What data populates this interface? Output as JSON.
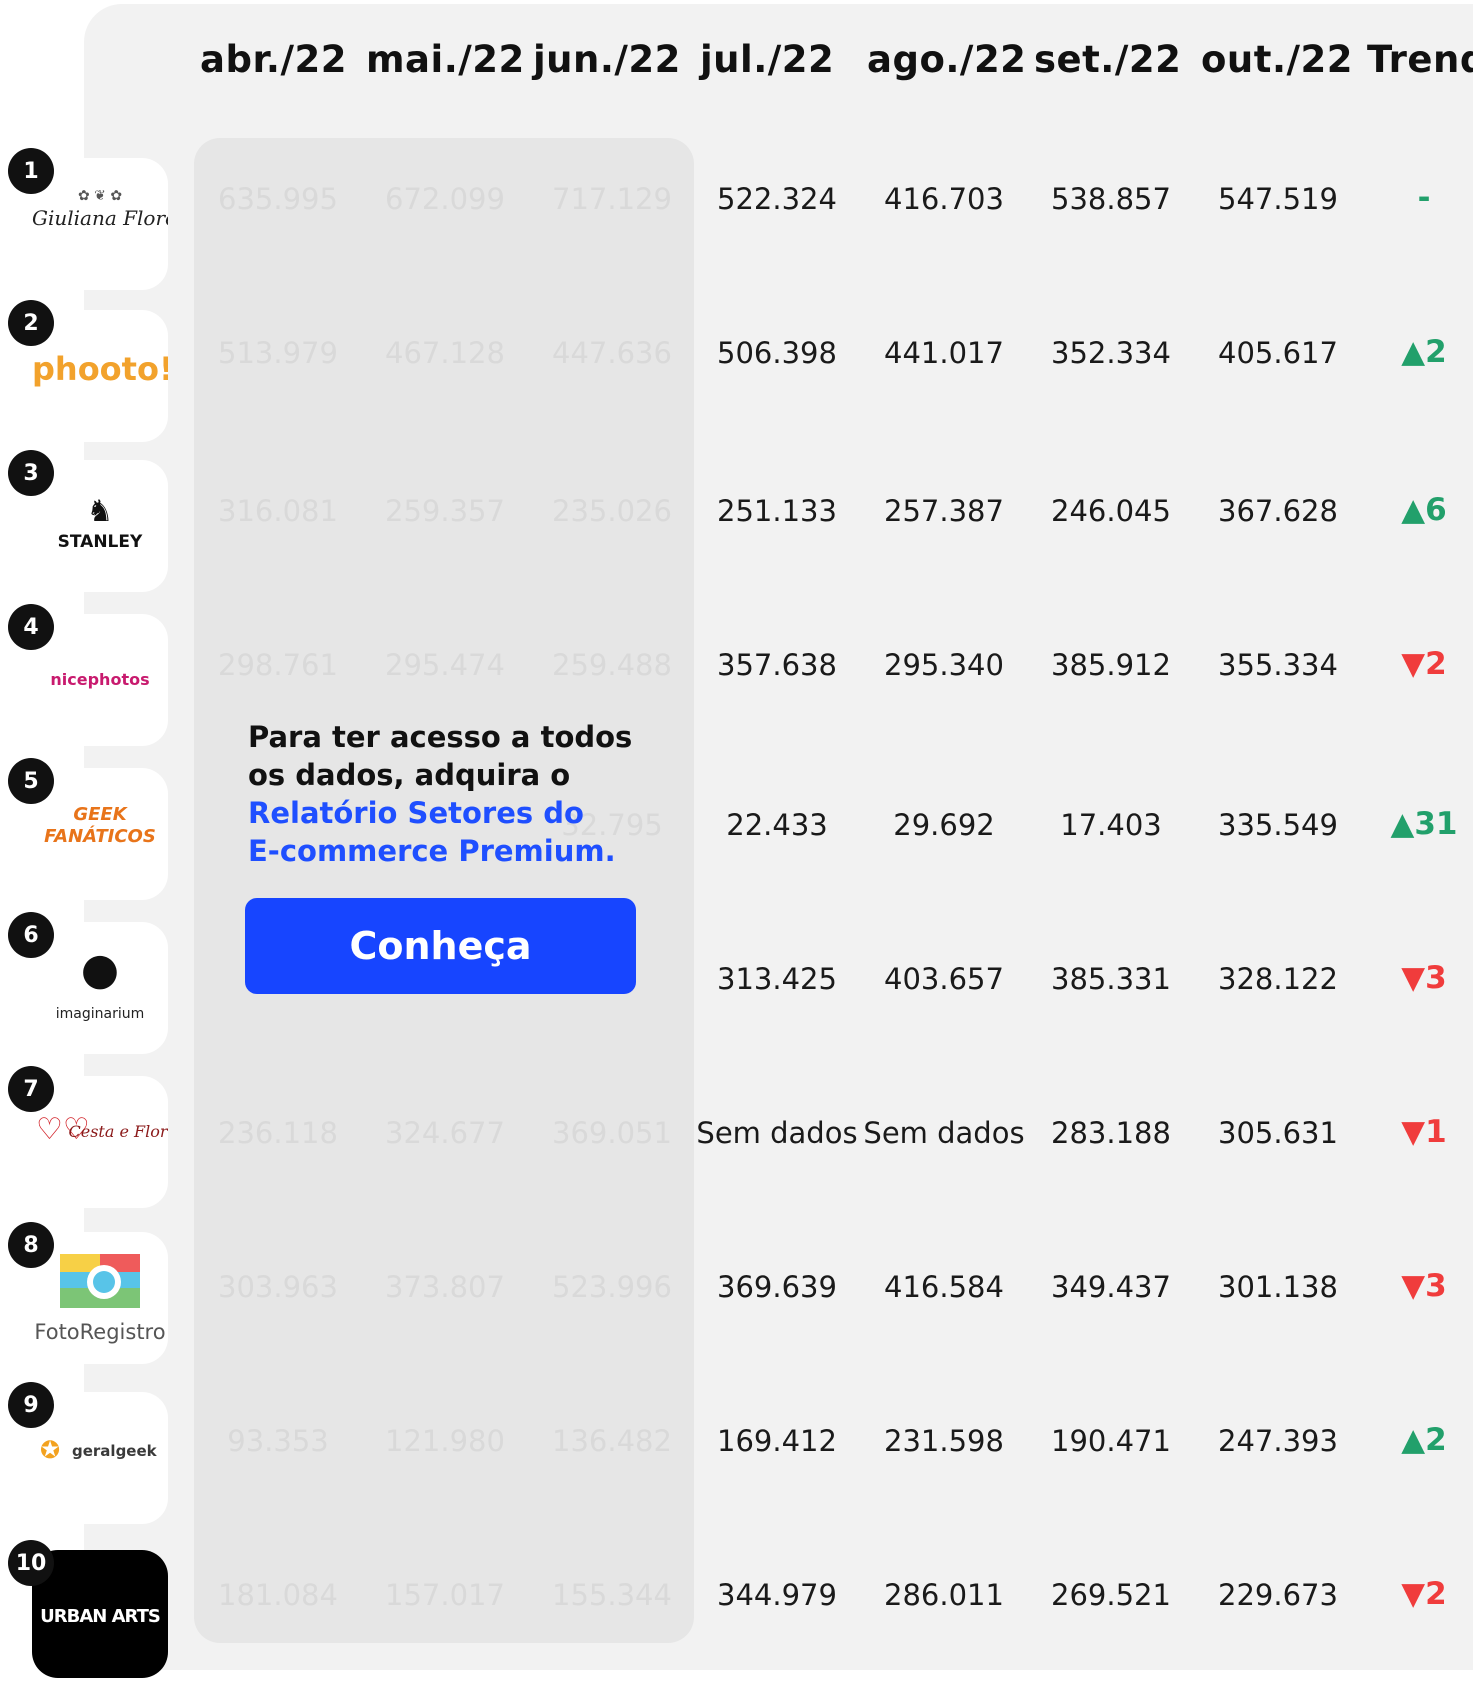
{
  "header": {
    "months": [
      "abr./22",
      "mai./22",
      "jun./22",
      "jul./22",
      "ago./22",
      "set./22",
      "out./22"
    ],
    "trend_label": "Trend"
  },
  "rows": [
    {
      "rank": "1",
      "brand": "Giuliana Flores",
      "hidden": [
        "635.995",
        "672.099",
        "717.129"
      ],
      "values": [
        "522.324",
        "416.703",
        "538.857",
        "547.519"
      ],
      "trend": "-",
      "direction": "none"
    },
    {
      "rank": "2",
      "brand": "phooto!",
      "hidden": [
        "513.979",
        "467.128",
        "447.636"
      ],
      "values": [
        "506.398",
        "441.017",
        "352.334",
        "405.617"
      ],
      "trend": "▲2",
      "direction": "up"
    },
    {
      "rank": "3",
      "brand": "STANLEY",
      "hidden": [
        "316.081",
        "259.357",
        "235.026"
      ],
      "values": [
        "251.133",
        "257.387",
        "246.045",
        "367.628"
      ],
      "trend": "▲6",
      "direction": "up"
    },
    {
      "rank": "4",
      "brand": "nicephotos",
      "hidden": [
        "298.761",
        "295.474",
        "259.488"
      ],
      "values": [
        "357.638",
        "295.340",
        "385.912",
        "355.334"
      ],
      "trend": "▼2",
      "direction": "down"
    },
    {
      "rank": "5",
      "brand": "GEEK FANÁTICOS",
      "hidden": [
        "",
        "",
        "32.795"
      ],
      "values": [
        "22.433",
        "29.692",
        "17.403",
        "335.549"
      ],
      "trend": "▲31",
      "direction": "up"
    },
    {
      "rank": "6",
      "brand": "imaginarium",
      "hidden": [
        "",
        "",
        ""
      ],
      "values": [
        "313.425",
        "403.657",
        "385.331",
        "328.122"
      ],
      "trend": "▼3",
      "direction": "down"
    },
    {
      "rank": "7",
      "brand": "Cesta e Flor",
      "hidden": [
        "236.118",
        "324.677",
        "369.051"
      ],
      "values": [
        "Sem dados",
        "Sem dados",
        "283.188",
        "305.631"
      ],
      "trend": "▼1",
      "direction": "down"
    },
    {
      "rank": "8",
      "brand": "FotoRegistro",
      "hidden": [
        "303.963",
        "373.807",
        "523.996"
      ],
      "values": [
        "369.639",
        "416.584",
        "349.437",
        "301.138"
      ],
      "trend": "▼3",
      "direction": "down"
    },
    {
      "rank": "9",
      "brand": "geralgeek",
      "hidden": [
        "93.353",
        "121.980",
        "136.482"
      ],
      "values": [
        "169.412",
        "231.598",
        "190.471",
        "247.393"
      ],
      "trend": "▲2",
      "direction": "up"
    },
    {
      "rank": "10",
      "brand": "URBAN ARTS",
      "hidden": [
        "181.084",
        "157.017",
        "155.344"
      ],
      "values": [
        "344.979",
        "286.011",
        "269.521",
        "229.673"
      ],
      "trend": "▼2",
      "direction": "down"
    }
  ],
  "paywall": {
    "line1": "Para ter acesso a todos",
    "line2": "os dados, adquira o",
    "link1": "Relatório Setores do",
    "link2": "E-commerce Premium.",
    "cta": "Conheça"
  },
  "colors": {
    "up": "#22a06b",
    "down": "#f03c3c",
    "cta": "#1745ff",
    "link": "#1f4fff"
  }
}
